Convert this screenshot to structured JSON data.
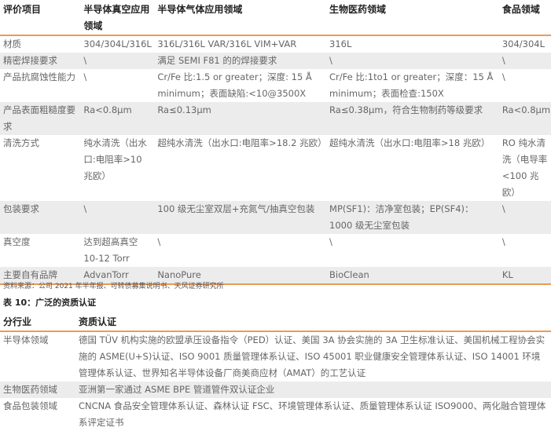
{
  "table9": {
    "headers": [
      "评价项目",
      "半导体真空应用领域",
      "半导体气体应用领域",
      "生物医药领域",
      "食品领域"
    ],
    "rows": [
      [
        "材质",
        "304/304L/316L",
        "316L/316L VAR/316L VIM+VAR",
        "316L",
        "304/304L"
      ],
      [
        "精密焊接要求",
        "\\",
        "满足 SEMI F81 的的焊接要求",
        "\\",
        "\\"
      ],
      [
        "产品抗腐蚀性能力",
        "\\",
        "Cr/Fe 比:1.5 or greater；深度: 15 Å minimum；表面缺陷:<10@3500X",
        "Cr/Fe 比:1to1 or greater；深度：15 Å minimum；表面检查:150X",
        "\\"
      ],
      [
        "产品表面粗糙度要求",
        "Ra<0.8μm",
        "Ra≤0.13μm",
        "Ra≤0.38μm，符合生物制药等级要求",
        "Ra<0.8μm"
      ],
      [
        "清洗方式",
        "纯水清洗（出水口:电阻率>10 兆欧）",
        "超纯水清洗（出水口:电阻率>18.2 兆欧）",
        "超纯水清洗（出水口:电阻率>18 兆欧）",
        "RO 纯水清洗（电导率<100 兆欧）"
      ],
      [
        "包装要求",
        "\\",
        "100 级无尘室双层+充氮气/抽真空包装",
        "MP(SF1)：洁净室包装；EP(SF4)：1000 级无尘室包装",
        "\\"
      ],
      [
        "真空度",
        "达到超高真空 10-12 Torr",
        "\\",
        "\\",
        "\\"
      ],
      [
        "主要自有品牌",
        "AdvanTorr",
        "NanoPure",
        "BioClean",
        "KL"
      ]
    ]
  },
  "source_note": "资料来源：公司 2021 年半年报、可转债募集说明书、天风证券研究所",
  "table10": {
    "caption": "表 10：广泛的资质认证",
    "headers": [
      "分行业",
      "资质认证"
    ],
    "rows": [
      [
        "半导体领域",
        "德国 TÜV 机构实施的欧盟承压设备指令（PED）认证、美国 3A 协会实施的 3A 卫生标准认证、美国机械工程协会实施的 ASME(U+S)认证、ISO 9001 质量管理体系认证、ISO 45001 职业健康安全管理体系认证、ISO 14001 环境管理体系认证、世界知名半导体设备厂商美商应材（AMAT）的工艺认证"
      ],
      [
        "生物医药领域",
        "亚洲第一家通过 ASME BPE 管道管件双认证企业"
      ],
      [
        "食品包装领域",
        "CNCNA 食品安全管理体系认证、森林认证 FSC、环境管理体系认证、质量管理体系认证 ISO9000、两化融合管理体系评定证书"
      ]
    ]
  }
}
